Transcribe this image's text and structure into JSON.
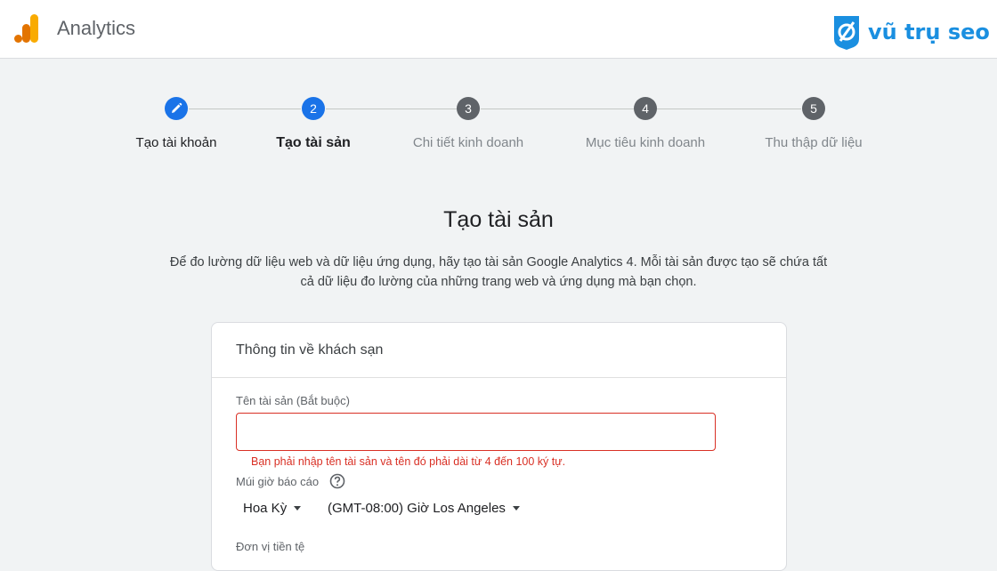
{
  "header": {
    "app_title": "Analytics",
    "brand_text": "vũ trụ seo",
    "logo_icon": "analytics-logo-icon",
    "brand_icon": "vutruseo-logo-icon",
    "colors": {
      "logo_orange": "#f9ab00",
      "logo_dark_orange": "#e37400",
      "brand_blue": "#1a8fe0"
    }
  },
  "stepper": {
    "steps": [
      {
        "marker": "",
        "label": "Tạo tài khoản",
        "state": "done",
        "icon": "pencil-icon"
      },
      {
        "marker": "2",
        "label": "Tạo tài sản",
        "state": "current"
      },
      {
        "marker": "3",
        "label": "Chi tiết kinh doanh",
        "state": "future"
      },
      {
        "marker": "4",
        "label": "Mục tiêu kinh doanh",
        "state": "future"
      },
      {
        "marker": "5",
        "label": "Thu thập dữ liệu",
        "state": "future"
      }
    ],
    "colors": {
      "active": "#1a73e8",
      "inactive": "#5f6368"
    }
  },
  "main": {
    "title": "Tạo tài sản",
    "description_line1": "Để đo lường dữ liệu web và dữ liệu ứng dụng, hãy tạo tài sản Google Analytics 4. Mỗi tài sản được tạo sẽ chứa tất",
    "description_line2": "cả dữ liệu đo lường của những trang web và ứng dụng mà bạn chọn."
  },
  "form": {
    "card_title": "Thông tin về khách sạn",
    "property_name_label": "Tên tài sản (Bắt buộc)",
    "property_name_value": "",
    "property_name_error": "Bạn phải nhập tên tài sản và tên đó phải dài từ 4 đến 100 ký tự.",
    "timezone_label": "Múi giờ báo cáo",
    "timezone_help_icon": "help-circle-icon",
    "country_value": "Hoa Kỳ",
    "timezone_value": "(GMT-08:00) Giờ Los Angeles",
    "currency_label": "Đơn vị tiền tệ",
    "colors": {
      "error": "#d93025"
    }
  }
}
